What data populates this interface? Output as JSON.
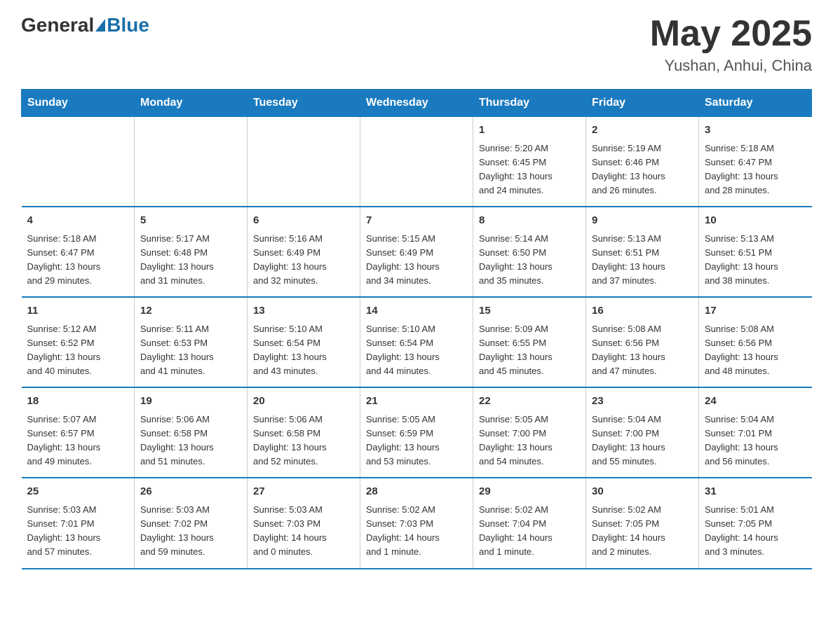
{
  "header": {
    "logo_general": "General",
    "logo_blue": "Blue",
    "month_title": "May 2025",
    "location": "Yushan, Anhui, China"
  },
  "weekdays": [
    "Sunday",
    "Monday",
    "Tuesday",
    "Wednesday",
    "Thursday",
    "Friday",
    "Saturday"
  ],
  "weeks": [
    [
      {
        "day": "",
        "info": ""
      },
      {
        "day": "",
        "info": ""
      },
      {
        "day": "",
        "info": ""
      },
      {
        "day": "",
        "info": ""
      },
      {
        "day": "1",
        "info": "Sunrise: 5:20 AM\nSunset: 6:45 PM\nDaylight: 13 hours\nand 24 minutes."
      },
      {
        "day": "2",
        "info": "Sunrise: 5:19 AM\nSunset: 6:46 PM\nDaylight: 13 hours\nand 26 minutes."
      },
      {
        "day": "3",
        "info": "Sunrise: 5:18 AM\nSunset: 6:47 PM\nDaylight: 13 hours\nand 28 minutes."
      }
    ],
    [
      {
        "day": "4",
        "info": "Sunrise: 5:18 AM\nSunset: 6:47 PM\nDaylight: 13 hours\nand 29 minutes."
      },
      {
        "day": "5",
        "info": "Sunrise: 5:17 AM\nSunset: 6:48 PM\nDaylight: 13 hours\nand 31 minutes."
      },
      {
        "day": "6",
        "info": "Sunrise: 5:16 AM\nSunset: 6:49 PM\nDaylight: 13 hours\nand 32 minutes."
      },
      {
        "day": "7",
        "info": "Sunrise: 5:15 AM\nSunset: 6:49 PM\nDaylight: 13 hours\nand 34 minutes."
      },
      {
        "day": "8",
        "info": "Sunrise: 5:14 AM\nSunset: 6:50 PM\nDaylight: 13 hours\nand 35 minutes."
      },
      {
        "day": "9",
        "info": "Sunrise: 5:13 AM\nSunset: 6:51 PM\nDaylight: 13 hours\nand 37 minutes."
      },
      {
        "day": "10",
        "info": "Sunrise: 5:13 AM\nSunset: 6:51 PM\nDaylight: 13 hours\nand 38 minutes."
      }
    ],
    [
      {
        "day": "11",
        "info": "Sunrise: 5:12 AM\nSunset: 6:52 PM\nDaylight: 13 hours\nand 40 minutes."
      },
      {
        "day": "12",
        "info": "Sunrise: 5:11 AM\nSunset: 6:53 PM\nDaylight: 13 hours\nand 41 minutes."
      },
      {
        "day": "13",
        "info": "Sunrise: 5:10 AM\nSunset: 6:54 PM\nDaylight: 13 hours\nand 43 minutes."
      },
      {
        "day": "14",
        "info": "Sunrise: 5:10 AM\nSunset: 6:54 PM\nDaylight: 13 hours\nand 44 minutes."
      },
      {
        "day": "15",
        "info": "Sunrise: 5:09 AM\nSunset: 6:55 PM\nDaylight: 13 hours\nand 45 minutes."
      },
      {
        "day": "16",
        "info": "Sunrise: 5:08 AM\nSunset: 6:56 PM\nDaylight: 13 hours\nand 47 minutes."
      },
      {
        "day": "17",
        "info": "Sunrise: 5:08 AM\nSunset: 6:56 PM\nDaylight: 13 hours\nand 48 minutes."
      }
    ],
    [
      {
        "day": "18",
        "info": "Sunrise: 5:07 AM\nSunset: 6:57 PM\nDaylight: 13 hours\nand 49 minutes."
      },
      {
        "day": "19",
        "info": "Sunrise: 5:06 AM\nSunset: 6:58 PM\nDaylight: 13 hours\nand 51 minutes."
      },
      {
        "day": "20",
        "info": "Sunrise: 5:06 AM\nSunset: 6:58 PM\nDaylight: 13 hours\nand 52 minutes."
      },
      {
        "day": "21",
        "info": "Sunrise: 5:05 AM\nSunset: 6:59 PM\nDaylight: 13 hours\nand 53 minutes."
      },
      {
        "day": "22",
        "info": "Sunrise: 5:05 AM\nSunset: 7:00 PM\nDaylight: 13 hours\nand 54 minutes."
      },
      {
        "day": "23",
        "info": "Sunrise: 5:04 AM\nSunset: 7:00 PM\nDaylight: 13 hours\nand 55 minutes."
      },
      {
        "day": "24",
        "info": "Sunrise: 5:04 AM\nSunset: 7:01 PM\nDaylight: 13 hours\nand 56 minutes."
      }
    ],
    [
      {
        "day": "25",
        "info": "Sunrise: 5:03 AM\nSunset: 7:01 PM\nDaylight: 13 hours\nand 57 minutes."
      },
      {
        "day": "26",
        "info": "Sunrise: 5:03 AM\nSunset: 7:02 PM\nDaylight: 13 hours\nand 59 minutes."
      },
      {
        "day": "27",
        "info": "Sunrise: 5:03 AM\nSunset: 7:03 PM\nDaylight: 14 hours\nand 0 minutes."
      },
      {
        "day": "28",
        "info": "Sunrise: 5:02 AM\nSunset: 7:03 PM\nDaylight: 14 hours\nand 1 minute."
      },
      {
        "day": "29",
        "info": "Sunrise: 5:02 AM\nSunset: 7:04 PM\nDaylight: 14 hours\nand 1 minute."
      },
      {
        "day": "30",
        "info": "Sunrise: 5:02 AM\nSunset: 7:05 PM\nDaylight: 14 hours\nand 2 minutes."
      },
      {
        "day": "31",
        "info": "Sunrise: 5:01 AM\nSunset: 7:05 PM\nDaylight: 14 hours\nand 3 minutes."
      }
    ]
  ]
}
